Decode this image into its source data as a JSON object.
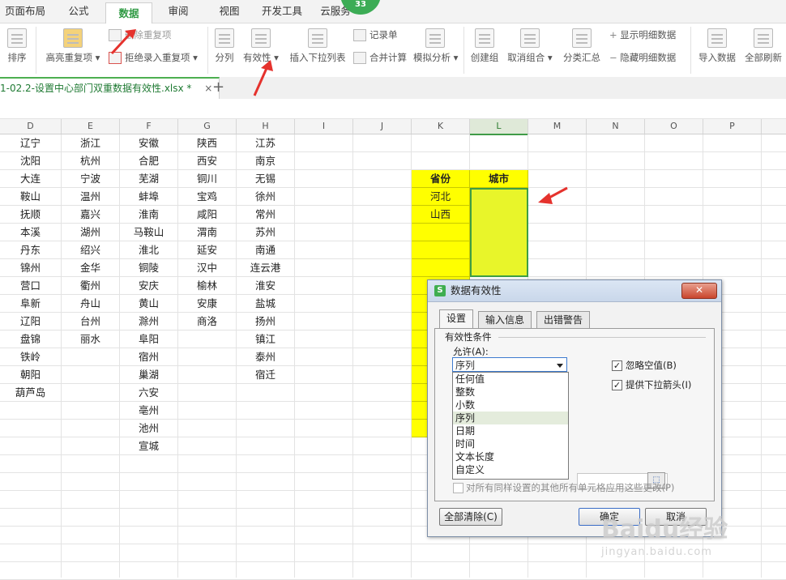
{
  "menubar": {
    "items": [
      {
        "label": "页面布局"
      },
      {
        "label": "公式"
      },
      {
        "label": "数据"
      },
      {
        "label": "审阅"
      },
      {
        "label": "视图"
      },
      {
        "label": "开发工具"
      },
      {
        "label": "云服务"
      }
    ],
    "active": "数据",
    "badge": "33"
  },
  "ribbon": {
    "sort_label": "排序",
    "highlight_dup_label": "高亮重复项",
    "remove_dup_label": "删除重复项",
    "reject_dup_label": "拒绝录入重复项",
    "split_label": "分列",
    "validity_label": "有效性",
    "insert_dropdown_label": "插入下拉列表",
    "record_label": "记录单",
    "merge_calc_label": "合并计算",
    "sim_analysis_label": "模拟分析",
    "create_group_label": "创建组",
    "ungroup_label": "取消组合",
    "subtotal_label": "分类汇总",
    "show_detail_label": "显示明细数据",
    "hide_detail_label": "隐藏明细数据",
    "import_label": "导入数据",
    "refresh_all_label": "全部刷新"
  },
  "tabs": {
    "file_tab": "1-02.2-设置中心部门双重数据有效性.xlsx *",
    "close_glyph": "×",
    "add_glyph": "+"
  },
  "columns": [
    "D",
    "E",
    "F",
    "G",
    "H",
    "I",
    "J",
    "K",
    "L",
    "M",
    "N",
    "O",
    "P"
  ],
  "sheet": {
    "col_D": [
      "辽宁",
      "沈阳",
      "大连",
      "鞍山",
      "抚顺",
      "本溪",
      "丹东",
      "锦州",
      "营口",
      "阜新",
      "辽阳",
      "盘锦",
      "铁岭",
      "朝阳",
      "葫芦岛"
    ],
    "col_E": [
      "浙江",
      "杭州",
      "宁波",
      "温州",
      "嘉兴",
      "湖州",
      "绍兴",
      "金华",
      "衢州",
      "舟山",
      "台州",
      "丽水"
    ],
    "col_F": [
      "安徽",
      "合肥",
      "芜湖",
      "蚌埠",
      "淮南",
      "马鞍山",
      "淮北",
      "铜陵",
      "安庆",
      "黄山",
      "滁州",
      "阜阳",
      "宿州",
      "巢湖",
      "六安",
      "亳州",
      "池州",
      "宣城"
    ],
    "col_G": [
      "陕西",
      "西安",
      "铜川",
      "宝鸡",
      "咸阳",
      "渭南",
      "延安",
      "汉中",
      "榆林",
      "安康",
      "商洛"
    ],
    "col_H": [
      "江苏",
      "南京",
      "无锡",
      "徐州",
      "常州",
      "苏州",
      "南通",
      "连云港",
      "淮安",
      "盐城",
      "扬州",
      "镇江",
      "泰州",
      "宿迁"
    ],
    "header_K": "省份",
    "header_L": "城市",
    "col_K_values": [
      "河北",
      "山西"
    ]
  },
  "dialog": {
    "title": "数据有效性",
    "close_glyph": "✕",
    "tabs": [
      "设置",
      "输入信息",
      "出错警告"
    ],
    "group_label": "有效性条件",
    "allow_label": "允许(A):",
    "allow_value": "序列",
    "options": [
      "任何值",
      "整数",
      "小数",
      "序列",
      "日期",
      "时间",
      "文本长度",
      "自定义"
    ],
    "selected_option": "序列",
    "ignore_blank_label": "忽略空值(B)",
    "ignore_blank_checked": true,
    "dropdown_arrow_label": "提供下拉箭头(I)",
    "dropdown_arrow_checked": true,
    "apply_all_label": "对所有同样设置的其他所有单元格应用这些更改(P)",
    "clear_all_label": "全部清除(C)",
    "ok_label": "确定",
    "cancel_label": "取消"
  },
  "watermark": {
    "text": "Baidu经验",
    "sub": "jingyan.baidu.com"
  },
  "colors": {
    "accent_green": "#2f9a43",
    "highlight_yellow": "#ffff00",
    "arrow_red": "#e5322d"
  }
}
